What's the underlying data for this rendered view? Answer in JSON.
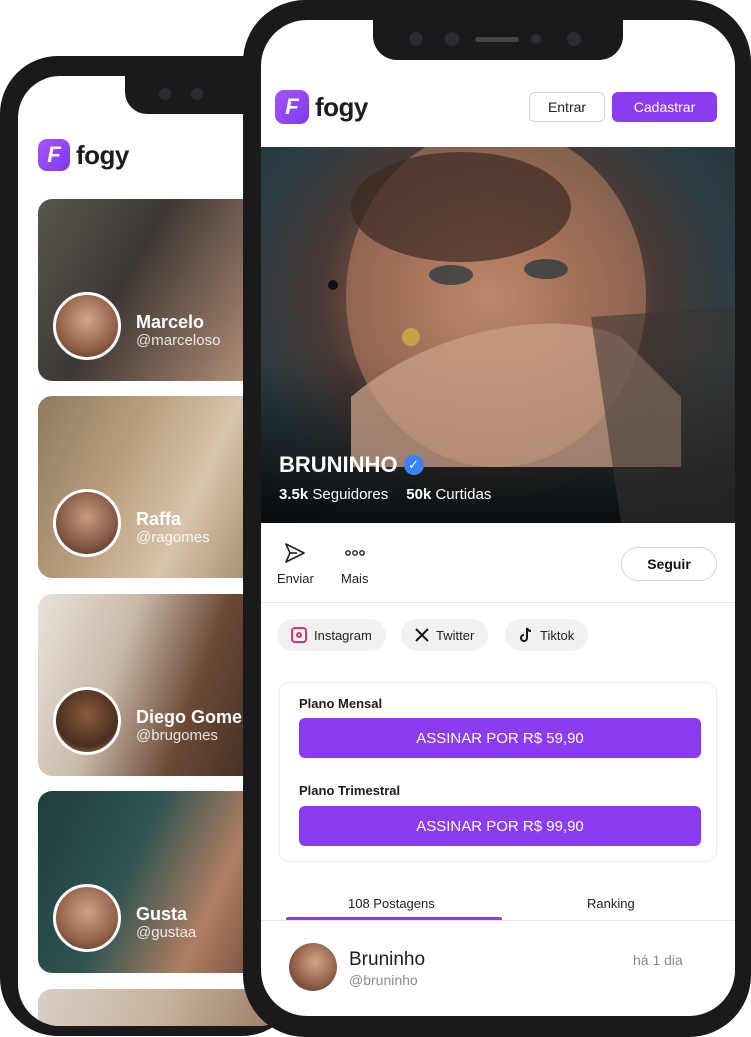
{
  "brand": {
    "logo_letter": "F",
    "name": "fogy",
    "accent": "#8b3bf0"
  },
  "feed": {
    "creators": [
      {
        "name": "Marcelo",
        "handle": "@marceloso"
      },
      {
        "name": "Raffa",
        "handle": "@ragomes"
      },
      {
        "name": "Diego Gomes",
        "handle": "@brugomes"
      },
      {
        "name": "Gusta",
        "handle": "@gustaa"
      }
    ]
  },
  "header": {
    "login_label": "Entrar",
    "signup_label": "Cadastrar"
  },
  "profile": {
    "name": "BRUNINHO",
    "verified_mark": "✓",
    "followers_value": "3.5k",
    "followers_label": "Seguidores",
    "likes_value": "50k",
    "likes_label": "Curtidas"
  },
  "actions": {
    "send_label": "Enviar",
    "more_label": "Mais",
    "follow_label": "Seguir"
  },
  "social_links": [
    {
      "label": "Instagram",
      "icon": "instagram-icon"
    },
    {
      "label": "Twitter",
      "icon": "x-icon"
    },
    {
      "label": "Tiktok",
      "icon": "tiktok-icon"
    }
  ],
  "plans": [
    {
      "title": "Plano Mensal",
      "button": "ASSINAR POR  R$ 59,90"
    },
    {
      "title": "Plano Trimestral",
      "button": "ASSINAR POR  R$ 99,90"
    }
  ],
  "tabs": [
    {
      "label": "108 Postagens",
      "active": true
    },
    {
      "label": "Ranking",
      "active": false
    }
  ],
  "post": {
    "author": "Bruninho",
    "handle": "@bruninho",
    "time": "há 1 dia"
  }
}
